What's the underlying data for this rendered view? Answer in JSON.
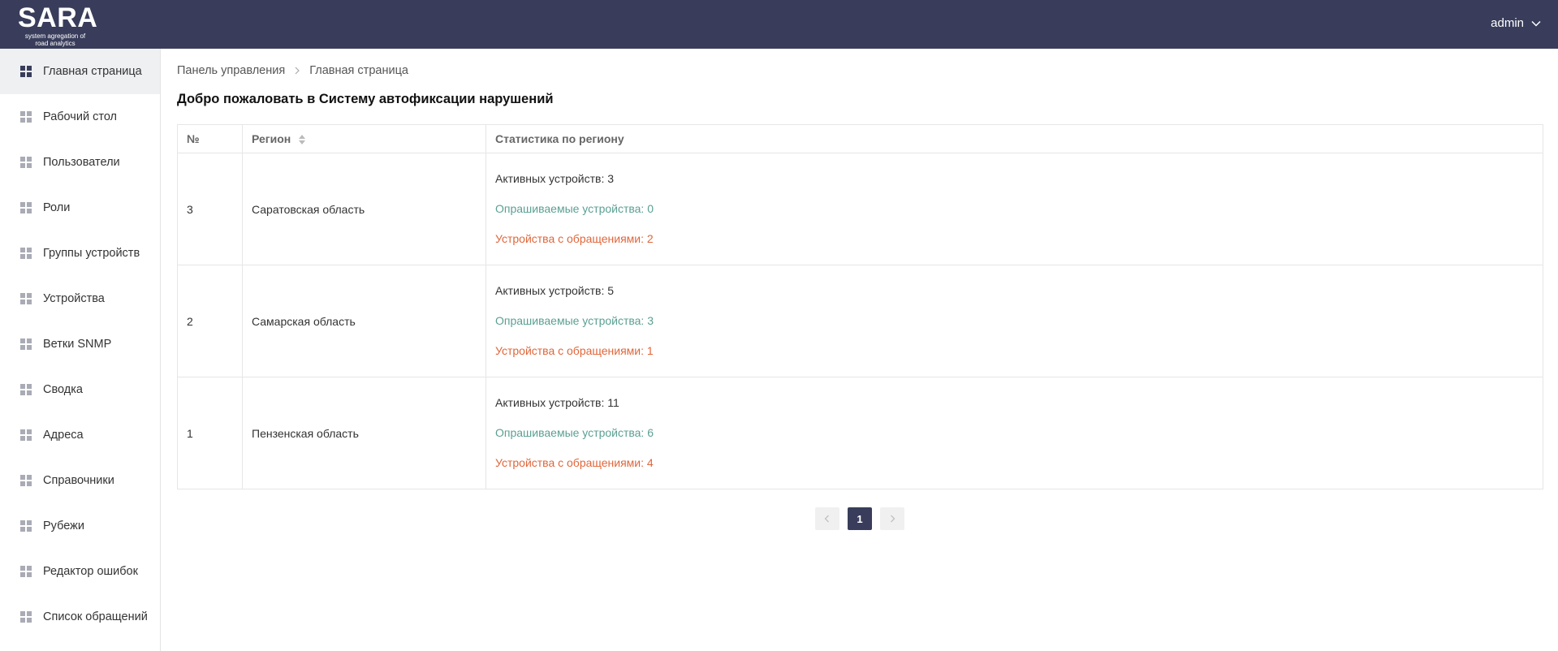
{
  "header": {
    "logo_title": "SARA",
    "logo_subtitle_line1": "system agregation of",
    "logo_subtitle_line2": "road analytics",
    "user": "admin"
  },
  "sidebar": {
    "items": [
      {
        "label": "Главная страница",
        "active": true
      },
      {
        "label": "Рабочий стол"
      },
      {
        "label": "Пользователи"
      },
      {
        "label": "Роли"
      },
      {
        "label": "Группы устройств"
      },
      {
        "label": "Устройства"
      },
      {
        "label": "Ветки SNMP"
      },
      {
        "label": "Сводка"
      },
      {
        "label": "Адреса"
      },
      {
        "label": "Справочники"
      },
      {
        "label": "Рубежи"
      },
      {
        "label": "Редактор ошибок"
      },
      {
        "label": "Список обращений"
      }
    ]
  },
  "breadcrumb": {
    "root": "Панель управления",
    "current": "Главная страница"
  },
  "page": {
    "title": "Добро пожаловать в Систему автофиксации нарушений"
  },
  "table": {
    "headers": {
      "num": "№",
      "region": "Регион",
      "stats": "Статистика по региону"
    },
    "rows": [
      {
        "num": "3",
        "region": "Саратовская область",
        "active": "Активных устройств: 3",
        "polled": "Опрашиваемые устройства: 0",
        "appeals": "Устройства с обращениями: 2"
      },
      {
        "num": "2",
        "region": "Самарская область",
        "active": "Активных устройств: 5",
        "polled": "Опрашиваемые устройства: 3",
        "appeals": "Устройства с обращениями: 1"
      },
      {
        "num": "1",
        "region": "Пензенская область",
        "active": "Активных устройств: 11",
        "polled": "Опрашиваемые устройства: 6",
        "appeals": "Устройства с обращениями: 4"
      }
    ]
  },
  "pagination": {
    "current_page": "1"
  },
  "colors": {
    "header_bg": "#393d5b",
    "polled_text": "#5aa092",
    "appeals_text": "#e0663a"
  },
  "icons": {
    "nav": "grid-icon",
    "user_menu": "chevron-down-icon",
    "breadcrumb_sep": "chevron-right-icon",
    "sort": "sort-icon",
    "prev": "chevron-left-icon",
    "next": "chevron-right-icon"
  }
}
